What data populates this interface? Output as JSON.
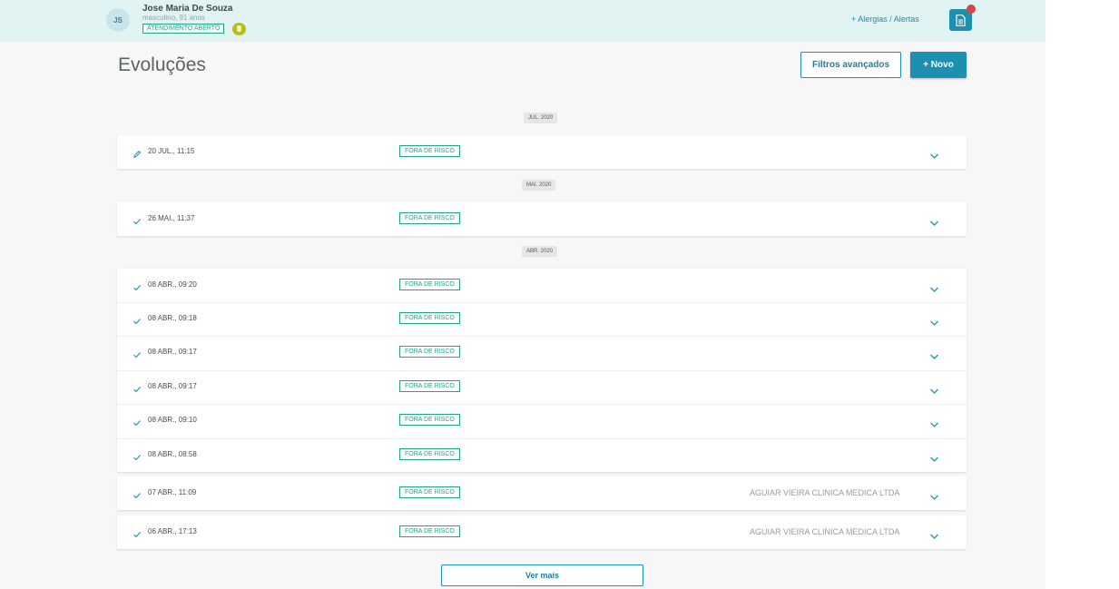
{
  "header": {
    "avatar_initials": "JS",
    "patient_name": "Jose Maria De Souza",
    "patient_info": "masculino, 91 anos",
    "status_tag": "ATENDIMENTO ABERTO",
    "allergy_link": "+ Alergias / Alertas",
    "icons": {
      "status": "badge-icon",
      "document": "document-icon"
    }
  },
  "page": {
    "title": "Evoluções",
    "filter_button": "Filtros avançados",
    "new_button": "+ Novo",
    "more_button": "Ver mais"
  },
  "months": [
    "JUL. 2020",
    "MAI. 2020",
    "ABR. 2020"
  ],
  "entries": [
    {
      "date": "20 JUL., 11:15",
      "tag": "FORA DE RISCO",
      "org": "",
      "status_icon": "pencil-icon"
    },
    {
      "date": "26 MAI., 11:37",
      "tag": "FORA DE RISCO",
      "org": "",
      "status_icon": "check-icon"
    },
    {
      "date": "08 ABR., 09:20",
      "tag": "FORA DE RISCO",
      "org": "",
      "status_icon": "check-icon"
    },
    {
      "date": "08 ABR., 09:18",
      "tag": "FORA DE RISCO",
      "org": "",
      "status_icon": "check-icon"
    },
    {
      "date": "08 ABR., 09:17",
      "tag": "FORA DE RISCO",
      "org": "",
      "status_icon": "check-icon"
    },
    {
      "date": "08 ABR., 09:17",
      "tag": "FORA DE RISCO",
      "org": "",
      "status_icon": "check-icon"
    },
    {
      "date": "08 ABR., 09:10",
      "tag": "FORA DE RISCO",
      "org": "",
      "status_icon": "check-icon"
    },
    {
      "date": "08 ABR., 08:58",
      "tag": "FORA DE RISCO",
      "org": "",
      "status_icon": "check-icon"
    },
    {
      "date": "07 ABR., 11:09",
      "tag": "FORA DE RISCO",
      "org": "AGUIAR VIEIRA CLINICA MEDICA LTDA",
      "status_icon": "check-icon"
    },
    {
      "date": "06 ABR., 17:13",
      "tag": "FORA DE RISCO",
      "org": "AGUIAR VIEIRA CLINICA MEDICA LTDA",
      "status_icon": "check-icon"
    }
  ],
  "colors": {
    "accent": "#1d8fb0",
    "tag_green": "#23a48a",
    "header_bg": "#e2f3f4",
    "notification": "#d84447"
  }
}
